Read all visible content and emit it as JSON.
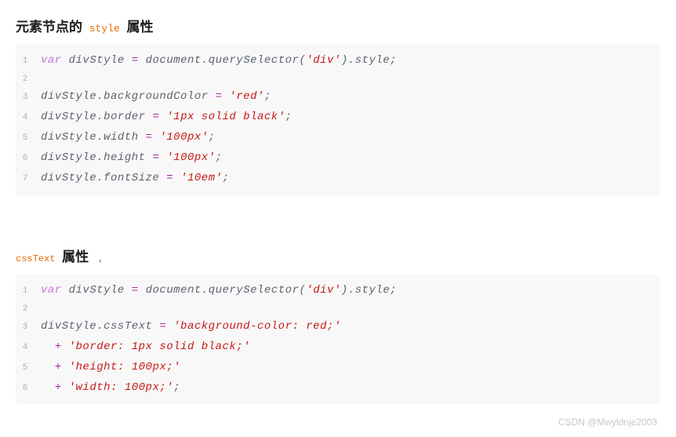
{
  "section1": {
    "title_prefix": "元素节点的",
    "title_code": "style",
    "title_suffix": "属性",
    "code": {
      "lines": [
        "var divStyle = document.querySelector('div').style;",
        "",
        "divStyle.backgroundColor = 'red';",
        "divStyle.border = '1px solid black';",
        "divStyle.width = '100px';",
        "divStyle.height = '100px';",
        "divStyle.fontSize = '10em';"
      ]
    }
  },
  "section2": {
    "title_code": "cssText",
    "title_suffix": "属性",
    "code": {
      "lines": [
        "var divStyle = document.querySelector('div').style;",
        "",
        "divStyle.cssText = 'background-color: red;'",
        "  + 'border: 1px solid black;'",
        "  + 'height: 100px;'",
        "  + 'width: 100px;';"
      ]
    }
  },
  "watermark": "CSDN @Mwyldnje2003",
  "line_numbers": {
    "block1": [
      "1",
      "2",
      "3",
      "4",
      "5",
      "6",
      "7"
    ],
    "block2": [
      "1",
      "2",
      "3",
      "4",
      "5",
      "6"
    ]
  },
  "tokens": {
    "var": "var",
    "divStyle": "divStyle",
    "eq": " = ",
    "document": "document",
    "dot": ".",
    "querySelector": "querySelector",
    "lparen": "(",
    "rparen": ")",
    "semi": ";",
    "plus": "+",
    "sq_div": "'div'",
    "style": "style",
    "backgroundColor": "backgroundColor",
    "border": "border",
    "width": "width",
    "height": "height",
    "fontSize": "fontSize",
    "cssText": "cssText",
    "str_red": "'red'",
    "str_1px_black": "'1px solid black'",
    "str_100px": "'100px'",
    "str_10em": "'10em'",
    "str_bg_red": "'background-color: red;'",
    "str_border_1px": "'border: 1px solid black;'",
    "str_height_100": "'height: 100px;'",
    "str_width_100": "'width: 100px;'"
  }
}
